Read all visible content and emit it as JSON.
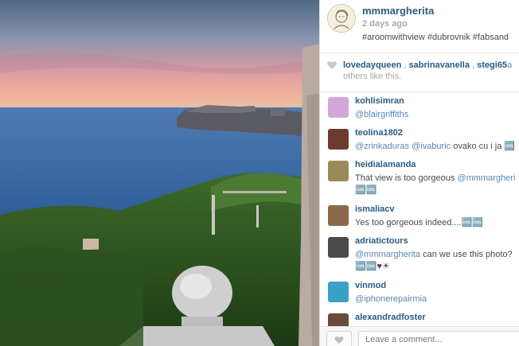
{
  "post": {
    "username": "mmmargherita",
    "time": "2 days ago",
    "caption": "#aroomwithview #dubrovnik #fabsand"
  },
  "likes": {
    "likers": [
      "lovedayqueen",
      "sabrinavanella",
      "stegi65"
    ],
    "trailing": "a",
    "suffix": "others like this."
  },
  "comments": [
    {
      "user": "kohlisimran",
      "mention": "@blairgriffiths",
      "text": "",
      "line2": "",
      "avatar_color": "#d3a6d9"
    },
    {
      "user": "teolina1802",
      "mention": "@zrinkaduras @ivaburic",
      "text": " ovako cu i ja 🆒",
      "line2": "",
      "avatar_color": "#6b3b2f"
    },
    {
      "user": "heidialamanda",
      "mention": "",
      "text": "That view is too gorgeous ",
      "mention2": "@mmmargheri",
      "line2": "🆒🆒",
      "avatar_color": "#9a8a5a"
    },
    {
      "user": "ismaliacv",
      "mention": "",
      "text": "Yes too gorgeous indeed....🆒🆒",
      "line2": "",
      "avatar_color": "#8a6a4a"
    },
    {
      "user": "adriatictours",
      "mention": "@mmmargherita",
      "text": " can we use this photo?",
      "line2": "🆒🆒♥☀",
      "avatar_color": "#4a4a4a"
    },
    {
      "user": "vinmod",
      "mention": "@iphonerepairmia",
      "text": "",
      "line2": "",
      "avatar_color": "#3aa0c8"
    },
    {
      "user": "alexandradfoster",
      "mention": "",
      "text": "",
      "line2": "",
      "avatar_color": "#6a4a3a"
    }
  ],
  "footer": {
    "comment_placeholder": "Leave a comment..."
  },
  "colors": {
    "username": "#2a5b83",
    "mention": "#5a87b4",
    "muted": "#a9a9a9"
  },
  "icons": [
    "heart-icon",
    "like-heart-icon"
  ]
}
